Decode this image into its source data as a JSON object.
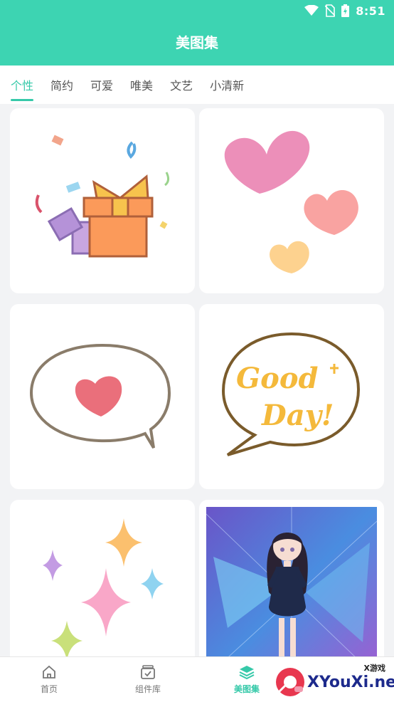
{
  "status_bar": {
    "time": "8:51",
    "icons": [
      "wifi-icon",
      "no-sim-icon",
      "battery-icon"
    ]
  },
  "header": {
    "title": "美图集"
  },
  "tabs": [
    {
      "label": "个性",
      "active": true
    },
    {
      "label": "简约",
      "active": false
    },
    {
      "label": "可爱",
      "active": false
    },
    {
      "label": "唯美",
      "active": false
    },
    {
      "label": "文艺",
      "active": false
    },
    {
      "label": "小清新",
      "active": false
    }
  ],
  "cards": [
    {
      "name": "gift-box-sticker"
    },
    {
      "name": "hearts-sticker"
    },
    {
      "name": "speech-bubble-heart-sticker"
    },
    {
      "name": "good-day-bubble-sticker",
      "text_line1": "Good",
      "text_line2": "Day!"
    },
    {
      "name": "sparkles-sticker"
    },
    {
      "name": "anime-girl-wallpaper"
    }
  ],
  "bottom_nav": [
    {
      "label": "首页",
      "icon": "home-icon",
      "active": false
    },
    {
      "label": "组件库",
      "icon": "widget-library-icon",
      "active": false
    },
    {
      "label": "美图集",
      "icon": "layers-icon",
      "active": true
    }
  ],
  "watermark": {
    "tag": "X游戏",
    "text": "XYouXi.net"
  },
  "colors": {
    "accent": "#3dd4b2",
    "tab_active": "#36c9a9",
    "background": "#f2f3f5"
  }
}
